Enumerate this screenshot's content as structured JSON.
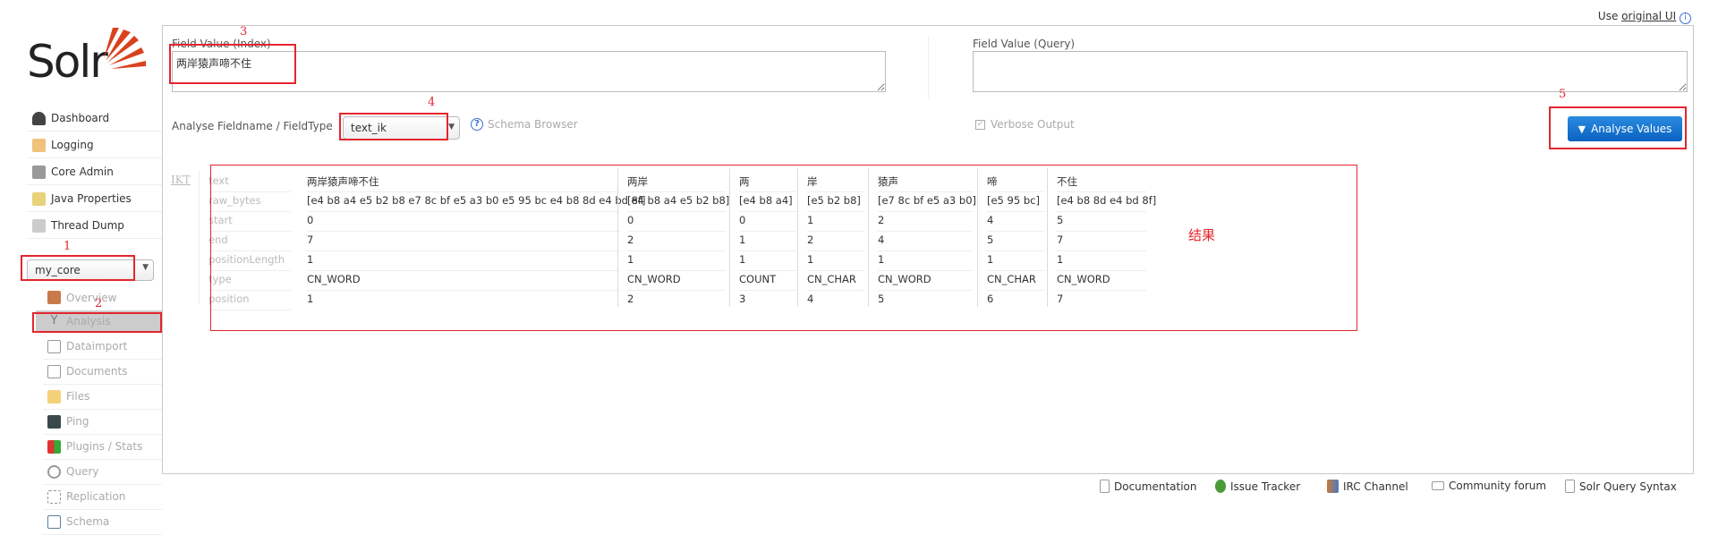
{
  "header": {
    "use_text": "Use",
    "original_ui_link": "original UI",
    "info_icon": "info-icon"
  },
  "logo": {
    "text": "Solr"
  },
  "sidebar": {
    "items": [
      {
        "label": "Dashboard",
        "icon": "dashboard-icon"
      },
      {
        "label": "Logging",
        "icon": "logging-icon"
      },
      {
        "label": "Core Admin",
        "icon": "core-admin-icon"
      },
      {
        "label": "Java Properties",
        "icon": "java-properties-icon"
      },
      {
        "label": "Thread Dump",
        "icon": "thread-dump-icon"
      }
    ],
    "core_select": {
      "value": "my_core"
    },
    "core_items": [
      {
        "label": "Overview",
        "icon": "home-icon"
      },
      {
        "label": "Analysis",
        "icon": "filter-icon",
        "active": true
      },
      {
        "label": "Dataimport",
        "icon": "dataimport-icon"
      },
      {
        "label": "Documents",
        "icon": "documents-icon"
      },
      {
        "label": "Files",
        "icon": "files-icon"
      },
      {
        "label": "Ping",
        "icon": "ping-icon"
      },
      {
        "label": "Plugins / Stats",
        "icon": "plugins-icon"
      },
      {
        "label": "Query",
        "icon": "query-icon"
      },
      {
        "label": "Replication",
        "icon": "replication-icon"
      },
      {
        "label": "Schema",
        "icon": "schema-icon"
      }
    ]
  },
  "analysis": {
    "index_label": "Field Value (Index)",
    "index_value": "两岸猿声啼不住",
    "query_label": "Field Value (Query)",
    "query_value": "",
    "fieldtype_label": "Analyse Fieldname / FieldType",
    "fieldtype_value": "text_ik",
    "schema_browser": "Schema Browser",
    "verbose_label": "Verbose Output",
    "verbose_checked": true,
    "analyse_button": "Analyse Values"
  },
  "results": {
    "analyzer": "IKT",
    "row_labels": [
      "text",
      "raw_bytes",
      "start",
      "end",
      "positionLength",
      "type",
      "position"
    ],
    "tokens": [
      [
        "两岸猿声啼不住",
        "[e4 b8 a4 e5 b2 b8 e7 8c bf e5 a3 b0 e5 95 bc e4 b8 8d e4 bd 8f]",
        "0",
        "7",
        "1",
        "CN_WORD",
        "1"
      ],
      [
        "两岸",
        "[e4 b8 a4 e5 b2 b8]",
        "0",
        "2",
        "1",
        "CN_WORD",
        "2"
      ],
      [
        "两",
        "[e4 b8 a4]",
        "0",
        "1",
        "1",
        "COUNT",
        "3"
      ],
      [
        "岸",
        "[e5 b2 b8]",
        "1",
        "2",
        "1",
        "CN_CHAR",
        "4"
      ],
      [
        "猿声",
        "[e7 8c bf e5 a3 b0]",
        "2",
        "4",
        "1",
        "CN_WORD",
        "5"
      ],
      [
        "啼",
        "[e5 95 bc]",
        "4",
        "5",
        "1",
        "CN_CHAR",
        "6"
      ],
      [
        "不住",
        "[e4 b8 8d e4 bd 8f]",
        "5",
        "7",
        "1",
        "CN_WORD",
        "7"
      ]
    ]
  },
  "annotations": {
    "n1": "1",
    "n2": "2",
    "n3": "3",
    "n4": "4",
    "n5": "5",
    "result": "结果",
    "color": "#e3262e"
  },
  "footer": [
    {
      "label": "Documentation",
      "icon": "documentation-icon"
    },
    {
      "label": "Issue Tracker",
      "icon": "bug-icon"
    },
    {
      "label": "IRC Channel",
      "icon": "irc-icon"
    },
    {
      "label": "Community forum",
      "icon": "mail-icon"
    },
    {
      "label": "Solr Query Syntax",
      "icon": "query-syntax-icon"
    }
  ],
  "colors": {
    "accent": "#1e7ad6",
    "annotation": "#e3262e",
    "solr_red": "#d9411e"
  }
}
